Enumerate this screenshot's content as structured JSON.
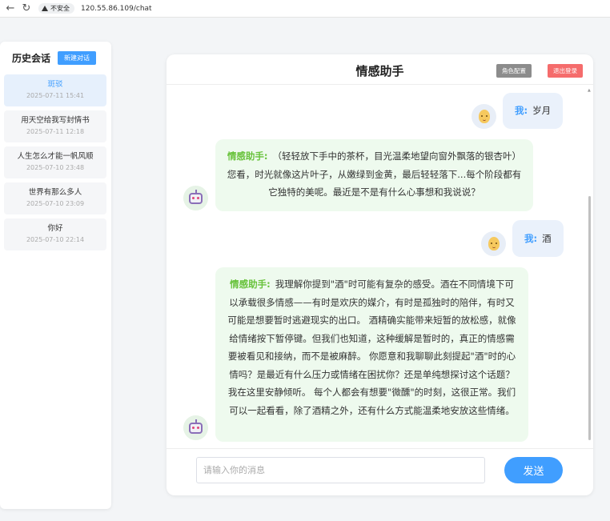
{
  "browser": {
    "back_icon": "←",
    "reload_icon": "↻",
    "security_label": "不安全",
    "url": "120.55.86.109/chat"
  },
  "sidebar": {
    "title": "历史会话",
    "new_chat_label": "新建对话",
    "conversations": [
      {
        "title": "斑驳",
        "time": "2025-07-11 15:41",
        "active": true
      },
      {
        "title": "用天空给我写封情书",
        "time": "2025-07-11 12:18"
      },
      {
        "title": "人生怎么才能一帆风顺",
        "time": "2025-07-10 23:48"
      },
      {
        "title": "世界有那么多人",
        "time": "2025-07-10 23:09"
      },
      {
        "title": "你好",
        "time": "2025-07-10 22:14"
      }
    ]
  },
  "chat": {
    "title": "情感助手",
    "role_button": "角色配置",
    "logout_button": "退出登录",
    "messages": [
      {
        "role": "user",
        "speaker": "我:",
        "text": "岁月"
      },
      {
        "role": "bot",
        "speaker": "情感助手:",
        "text": "（轻轻放下手中的茶杯，目光温柔地望向窗外飘落的银杏叶）您看，时光就像这片叶子，从嫩绿到金黄，最后轻轻落下...每个阶段都有它独特的美呢。最近是不是有什么心事想和我说说？"
      },
      {
        "role": "user",
        "speaker": "我:",
        "text": "酒"
      },
      {
        "role": "bot",
        "speaker": "情感助手:",
        "text": "我理解你提到\"酒\"时可能有复杂的感受。酒在不同情境下可以承载很多情感——有时是欢庆的媒介，有时是孤独时的陪伴，有时又可能是想要暂时逃避现实的出口。 酒精确实能带来短暂的放松感，就像给情绪按下暂停键。但我们也知道，这种缓解是暂时的，真正的情感需要被看见和接纳，而不是被麻醉。 你愿意和我聊聊此刻提起\"酒\"时的心情吗？是最近有什么压力或情绪在困扰你？还是单纯想探讨这个话题？我在这里安静倾听。 每个人都会有想要\"微醺\"的时刻，这很正常。我们可以一起看看，除了酒精之外，还有什么方式能温柔地安放这些情绪。"
      }
    ],
    "input_placeholder": "请输入你的消息",
    "send_label": "发送"
  },
  "colors": {
    "accent": "#409eff",
    "danger": "#f56c6c",
    "bot_name": "#67c23a",
    "user_bubble": "#eaf1fb",
    "bot_bubble": "#eefaee"
  }
}
